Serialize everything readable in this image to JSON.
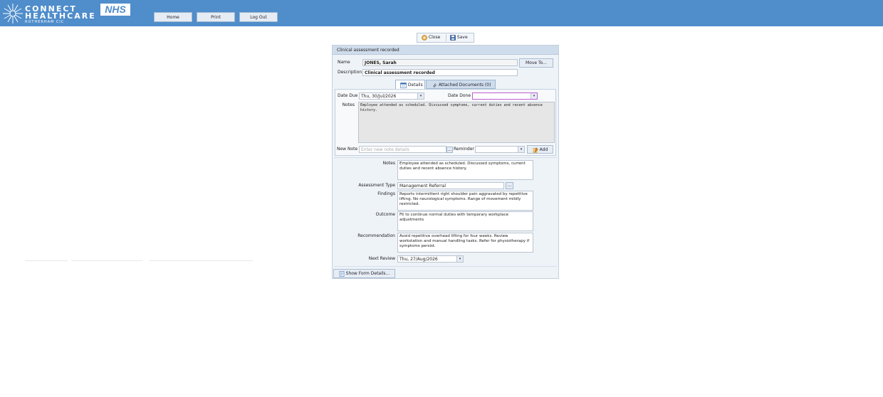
{
  "header": {
    "logo_line1": "CONNECT",
    "logo_line2": "HEALTHCARE",
    "logo_line3": "ROTHERHAM CIC",
    "nhs_logo": "NHS",
    "nav": [
      {
        "label": "Home"
      },
      {
        "label": "Print"
      },
      {
        "label": "Log Out"
      }
    ],
    "accent": "#4f8dcb"
  },
  "toolbar": {
    "close_label": "Close",
    "save_label": "Save"
  },
  "panel": {
    "title": "Clinical assessment recorded",
    "name_label": "Name",
    "name_value": "JONES, Sarah",
    "move_button": "Move To...",
    "description_label": "Description",
    "description_value": "Clinical assessment recorded",
    "tabs": [
      {
        "label": "Details",
        "icon": "calendar-icon"
      },
      {
        "label": "Attached Documents (0)",
        "icon": "paperclip-icon"
      }
    ],
    "details": {
      "date_due_label": "Date Due",
      "date_due_value": "Thu, 30/Jul/2026",
      "date_done_label": "Date Done",
      "date_done_value": "",
      "notes_label": "Notes",
      "notes_value": "Employee attended as scheduled. Discussed symptoms, current duties and recent absence history.",
      "new_note_label": "New Note",
      "new_note_placeholder": "Enter new note details",
      "reminder_label": "Reminder",
      "reminder_value": "",
      "add_button": "Add",
      "dots": "..."
    },
    "form": {
      "notes_label": "Notes",
      "notes_value": "Employee attended as scheduled. Discussed symptoms, current duties and recent absence history.",
      "assessment_type_label": "Assessment Type",
      "assessment_type_value": "Management Referral",
      "findings_label": "Findings",
      "findings_value": "Reports intermittent right shoulder pain aggravated by repetitive lifting. No neurological symptoms. Range of movement mildly restricted.",
      "outcome_label": "Outcome",
      "outcome_value": "Fit to continue normal duties with temporary workplace adjustments",
      "recommendation_label": "Recommendation",
      "recommendation_value": "Avoid repetitive overhead lifting for four weeks. Review workstation and manual handling tasks. Refer for physiotherapy if symptoms persist.",
      "next_review_label": "Next Review",
      "next_review_value": "Thu, 27/Aug/2026"
    },
    "show_form_button": "Show Form Details..."
  },
  "dropdown_arrow": "▾"
}
